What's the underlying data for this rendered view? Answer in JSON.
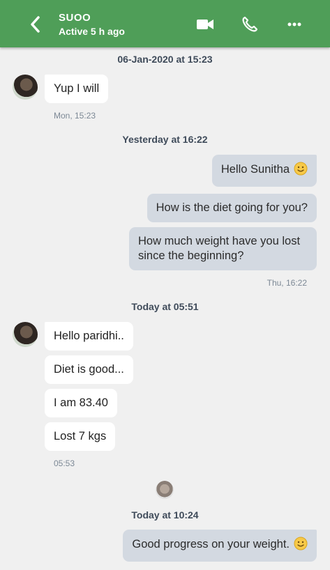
{
  "header": {
    "title": "SUOO",
    "status": "Active 5 h ago",
    "colors": {
      "bar": "#4f9e58",
      "bubble_out": "#d3d9e1",
      "bubble_in": "#ffffff"
    }
  },
  "dividers": [
    "06-Jan-2020 at 15:23",
    "Yesterday at 16:22",
    "Today at 05:51",
    "Today at 10:24"
  ],
  "messages": {
    "m1": "Yup I will",
    "t1": "Mon, 15:23",
    "m2": "Hello Sunitha",
    "m3": "How is the diet going for you?",
    "m4a": "How much weight have you lost",
    "m4b": "since the beginning?",
    "t2": "Thu, 16:22",
    "m5": "Hello paridhi..",
    "m6": "Diet is good...",
    "m7": "I am 83.40",
    "m8": "Lost 7 kgs",
    "t3": "05:53",
    "m9": "Good progress on your weight."
  }
}
